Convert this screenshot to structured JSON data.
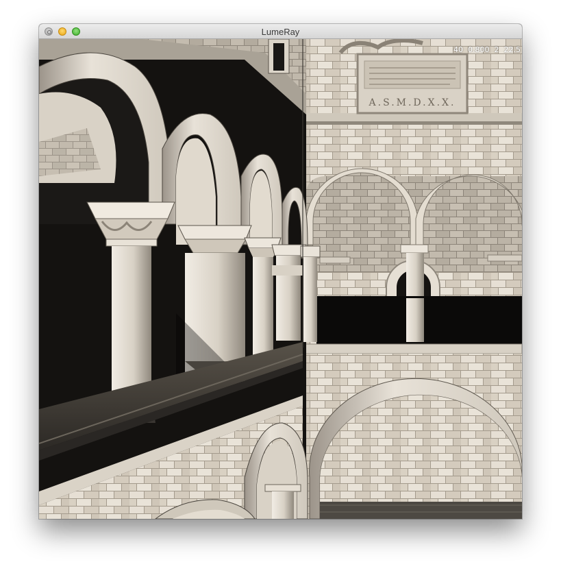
{
  "window": {
    "title": "LumeRay"
  },
  "overlay": {
    "stats": "40  0.800  2  22.5"
  },
  "scene": {
    "inscription": "A.S.M.D.X.X.",
    "colors": {
      "stone_light": "#e6dfd3",
      "stone_mid": "#cbc3b6",
      "stone_dark": "#8e877d",
      "shadow": "#0b0a09"
    }
  }
}
